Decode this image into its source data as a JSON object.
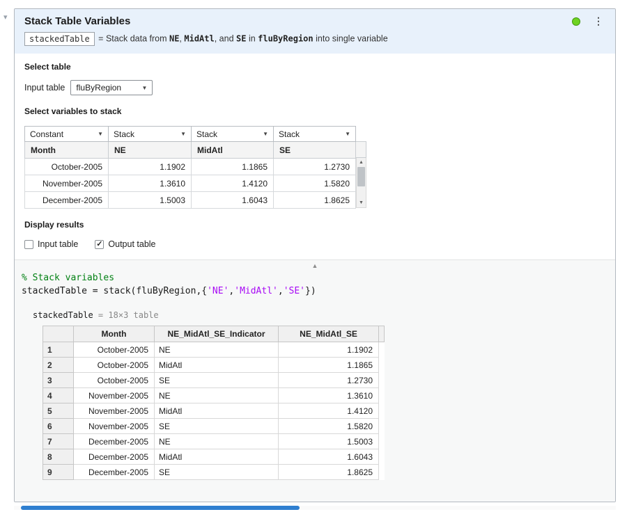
{
  "icons": {
    "caret_down": "▾",
    "menu": "⋮",
    "dropdown": "▼",
    "up_small": "▲",
    "down_small": "▼",
    "check": "✓"
  },
  "colors": {
    "header_bg": "#e8f1fb",
    "status_green": "#6ed321",
    "comment_green": "#028013",
    "string_purple": "#a709f5",
    "scrollbar_blue": "#2f7fd0"
  },
  "header": {
    "title": "Stack Table Variables",
    "summary": {
      "var_box": "stackedTable",
      "eq": " = ",
      "seg1": "Stack data from ",
      "seg2": "NE",
      "seg3": ", ",
      "seg4": "MidAtl",
      "seg5": ", and ",
      "seg6": "SE",
      "seg7": " in ",
      "seg8": "fluByRegion",
      "seg9": " into single variable"
    }
  },
  "select_table": {
    "heading": "Select table",
    "input_label": "Input table",
    "dropdown_value": "fluByRegion"
  },
  "select_variables": {
    "heading": "Select variables to stack",
    "dropdowns": [
      "Constant",
      "Stack",
      "Stack",
      "Stack"
    ],
    "columns": [
      "Month",
      "NE",
      "MidAtl",
      "SE"
    ],
    "rows": [
      [
        "October-2005",
        "1.1902",
        "1.1865",
        "1.2730"
      ],
      [
        "November-2005",
        "1.3610",
        "1.4120",
        "1.5820"
      ],
      [
        "December-2005",
        "1.5003",
        "1.6043",
        "1.8625"
      ]
    ]
  },
  "display_results": {
    "heading": "Display results",
    "checkboxes": [
      {
        "label": "Input table",
        "checked": false
      },
      {
        "label": "Output table",
        "checked": true
      }
    ]
  },
  "code": {
    "comment": "% Stack variables",
    "s0": "stackedTable = stack(fluByRegion,{",
    "s1": "'NE'",
    "s2": ",",
    "s3": "'MidAtl'",
    "s4": ",",
    "s5": "'SE'",
    "s6": "})"
  },
  "output": {
    "var_name": "stackedTable",
    "eq": " = ",
    "dims": "18×3 table",
    "columns": [
      "Month",
      "NE_MidAtl_SE_Indicator",
      "NE_MidAtl_SE"
    ],
    "rows": [
      {
        "n": "1",
        "month": "October-2005",
        "ind": "NE",
        "val": "1.1902"
      },
      {
        "n": "2",
        "month": "October-2005",
        "ind": "MidAtl",
        "val": "1.1865"
      },
      {
        "n": "3",
        "month": "October-2005",
        "ind": "SE",
        "val": "1.2730"
      },
      {
        "n": "4",
        "month": "November-2005",
        "ind": "NE",
        "val": "1.3610"
      },
      {
        "n": "5",
        "month": "November-2005",
        "ind": "MidAtl",
        "val": "1.4120"
      },
      {
        "n": "6",
        "month": "November-2005",
        "ind": "SE",
        "val": "1.5820"
      },
      {
        "n": "7",
        "month": "December-2005",
        "ind": "NE",
        "val": "1.5003"
      },
      {
        "n": "8",
        "month": "December-2005",
        "ind": "MidAtl",
        "val": "1.6043"
      },
      {
        "n": "9",
        "month": "December-2005",
        "ind": "SE",
        "val": "1.8625"
      }
    ]
  }
}
